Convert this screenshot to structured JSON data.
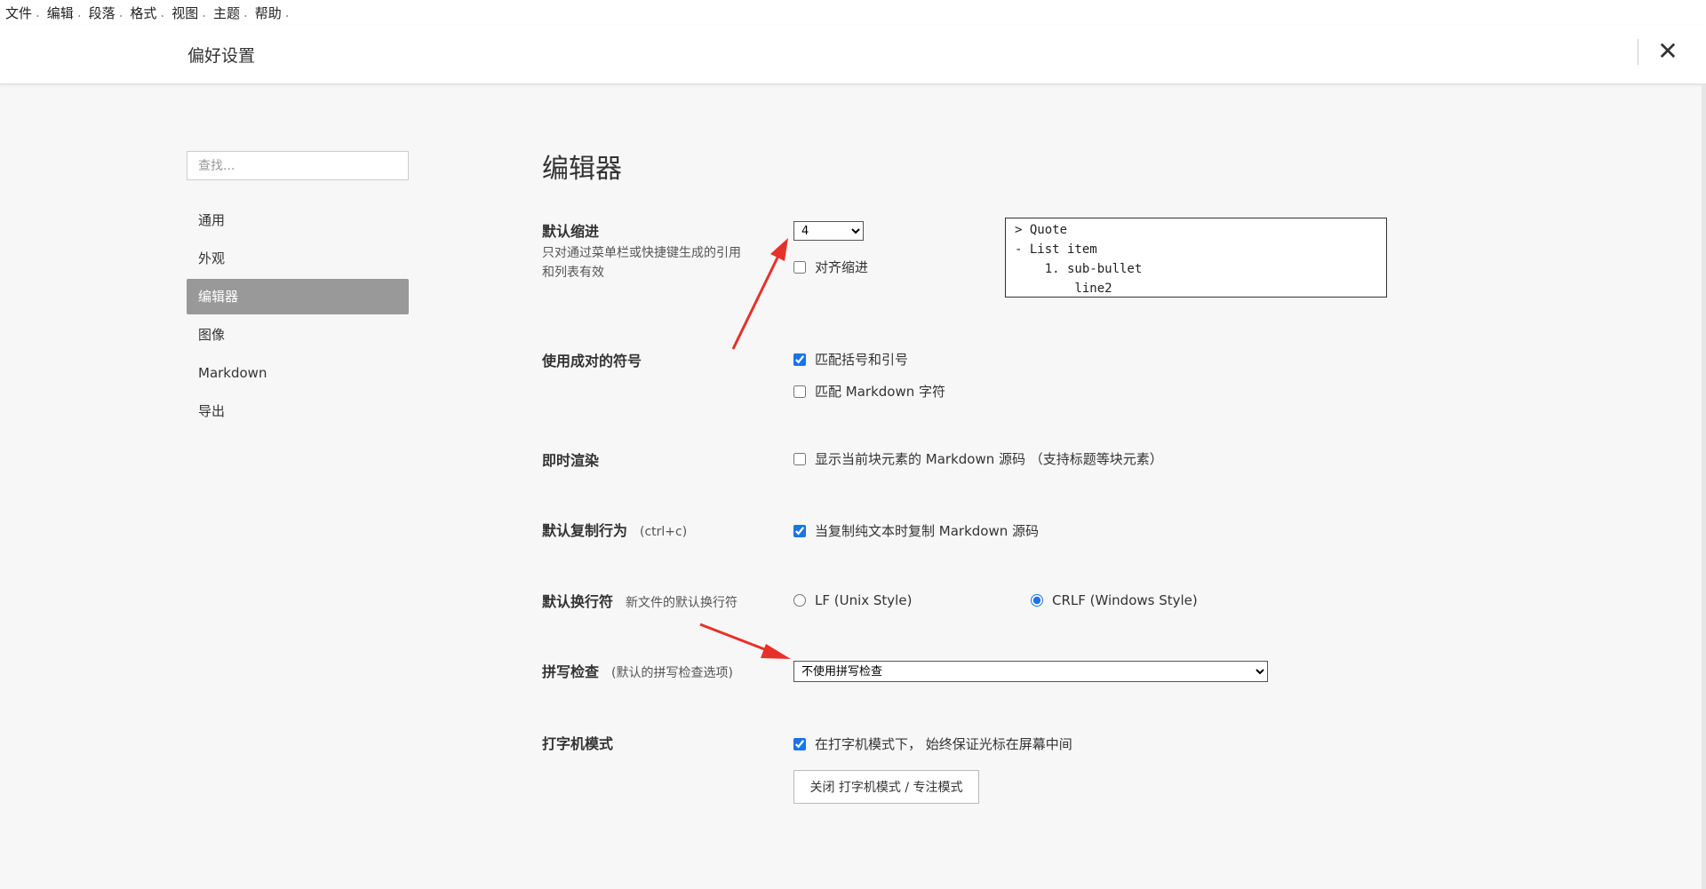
{
  "menubar": {
    "items": [
      "文件",
      "编辑",
      "段落",
      "格式",
      "视图",
      "主题",
      "帮助"
    ],
    "separator": "."
  },
  "header": {
    "title": "偏好设置",
    "close_icon": "close-icon"
  },
  "sidebar": {
    "search_placeholder": "查找...",
    "items": [
      {
        "label": "通用",
        "active": false
      },
      {
        "label": "外观",
        "active": false
      },
      {
        "label": "编辑器",
        "active": true
      },
      {
        "label": "图像",
        "active": false
      },
      {
        "label": "Markdown",
        "active": false
      },
      {
        "label": "导出",
        "active": false
      }
    ]
  },
  "main": {
    "title": "编辑器",
    "indent": {
      "label": "默认缩进",
      "desc_line1": "只对通过菜单栏或快捷键生成的引用",
      "desc_line2": "和列表有效",
      "value": "4",
      "align_label": "对齐缩进",
      "align_checked": false,
      "preview": "> Quote\n- List item\n    1. sub-bullet\n        line2"
    },
    "pairs": {
      "label": "使用成对的符号",
      "match_brackets_label": "匹配括号和引号",
      "match_brackets_checked": true,
      "match_markdown_label": "匹配 Markdown 字符",
      "match_markdown_checked": false
    },
    "live_render": {
      "label": "即时渲染",
      "option_label": "显示当前块元素的 Markdown 源码 （支持标题等块元素）",
      "option_checked": false
    },
    "copy": {
      "label": "默认复制行为",
      "note": "(ctrl+c)",
      "option_label": "当复制纯文本时复制 Markdown 源码",
      "option_checked": true
    },
    "line_ending": {
      "label": "默认换行符",
      "note": "新文件的默认换行符",
      "lf_label": "LF (Unix Style)",
      "crlf_label": "CRLF (Windows Style)",
      "selected": "crlf"
    },
    "spellcheck": {
      "label": "拼写检查",
      "note": "(默认的拼写检查选项)",
      "value": "不使用拼写检查"
    },
    "typewriter": {
      "label": "打字机模式",
      "option_label": "在打字机模式下， 始终保证光标在屏幕中间",
      "option_checked": true,
      "button_label": "关闭 打字机模式 / 专注模式"
    }
  },
  "colors": {
    "accent": "#1a73e8",
    "arrow": "#e8302a",
    "active_nav": "#999999"
  }
}
